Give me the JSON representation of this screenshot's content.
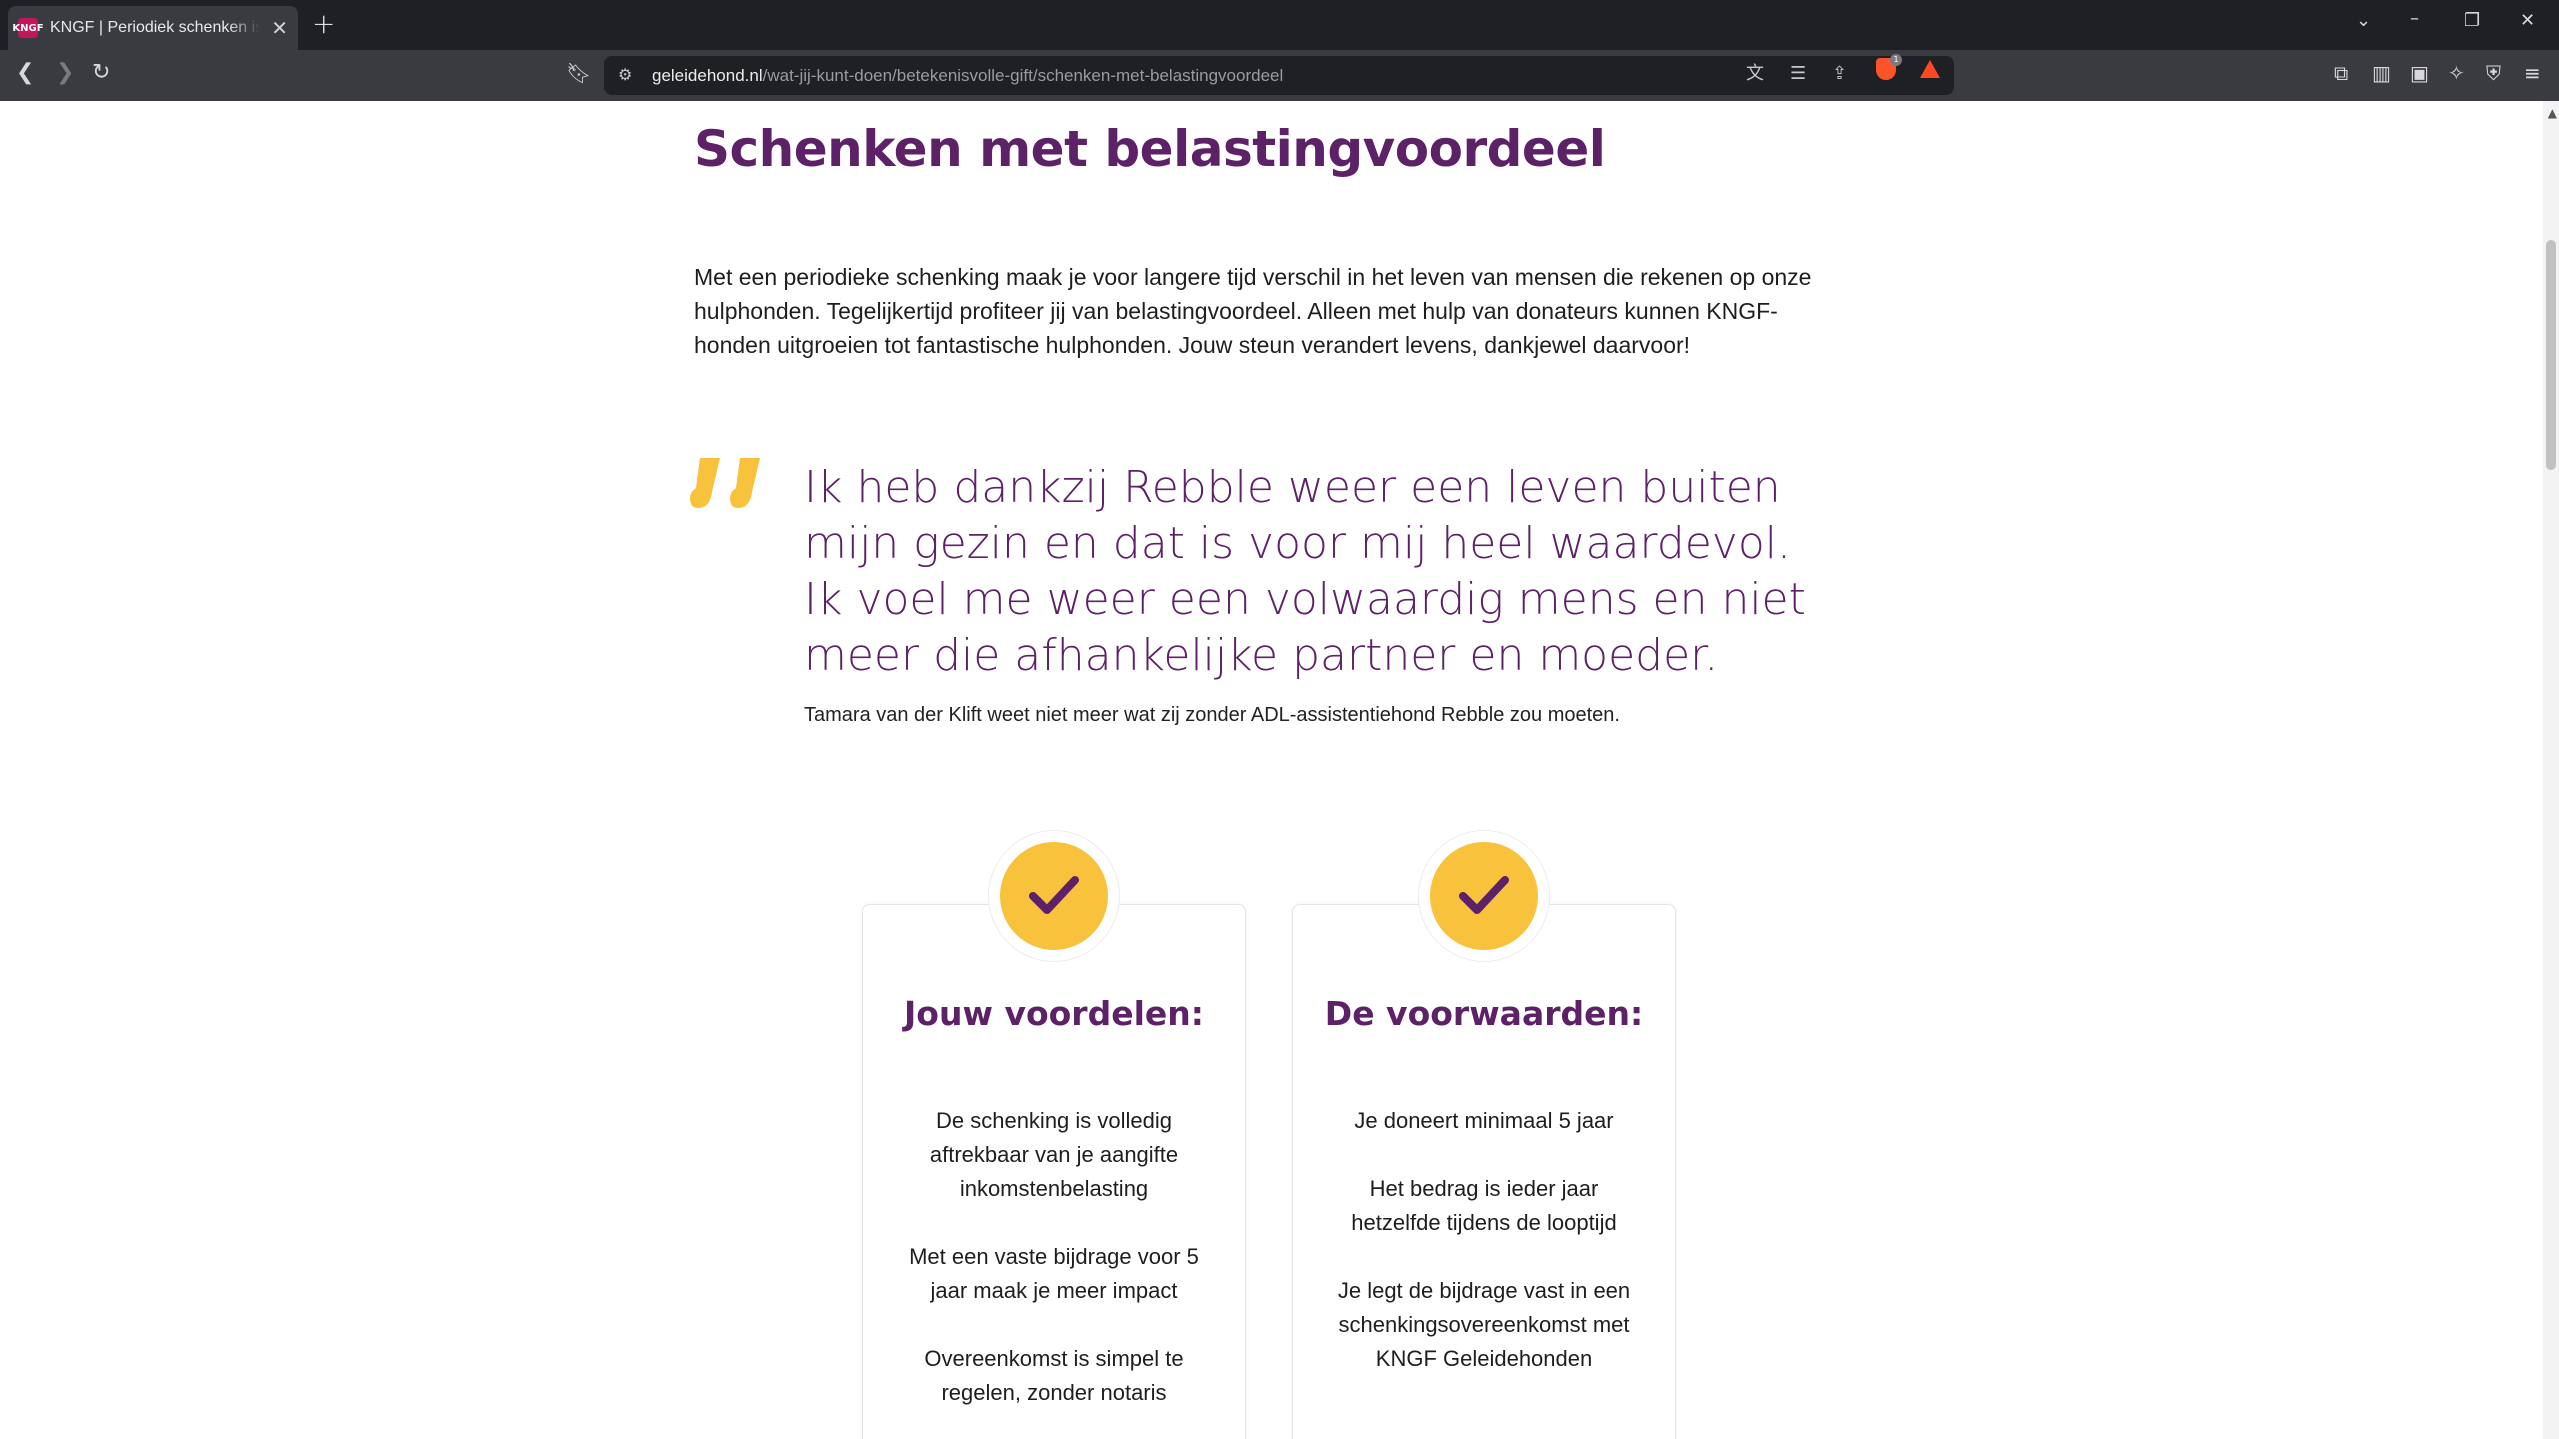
{
  "browser": {
    "tab": {
      "favicon": "KNGF",
      "title": "KNGF | Periodiek schenken is al"
    },
    "url": {
      "domain": "geleidehond.nl",
      "path": "/wat-jij-kunt-doen/betekenisvolle-gift/schenken-met-belastingvoordeel"
    },
    "brave_badge": "1"
  },
  "page": {
    "title": "Schenken met belastingvoordeel",
    "intro": "Met een periodieke schenking maak je voor langere tijd verschil in het leven van mensen die rekenen op onze hulphonden. Tegelijkertijd profiteer jij van belastingvoordeel. Alleen met hulp van donateurs kunnen KNGF-honden uitgroeien tot fantastische hulphonden. Jouw steun verandert levens, dankjewel daarvoor!",
    "quote": {
      "text": "Ik heb dankzij Rebble weer een leven buiten mijn gezin en dat is voor mij heel waardevol. Ik voel me weer een volwaardig mens en niet meer die afhankelijke partner en moeder.",
      "attribution": "Tamara van der Klift weet niet meer wat zij zonder ADL-assistentiehond Rebble zou moeten."
    },
    "cards": [
      {
        "title": "Jouw voordelen:",
        "items": [
          "De schenking is volledig aftrekbaar van je aangifte inkomstenbelasting",
          "Met een vaste bijdrage voor 5 jaar maak je meer impact",
          "Overeenkomst is simpel te regelen, zonder notaris"
        ]
      },
      {
        "title": "De voorwaarden:",
        "items": [
          "Je doneert minimaal 5 jaar",
          "Het bedrag is ieder jaar hetzelfde tijdens de looptijd",
          "Je legt de bijdrage vast in een schenkingsovereenkomst met KNGF Geleidehonden"
        ]
      }
    ]
  },
  "colors": {
    "brand_purple": "#5c2166",
    "accent_yellow": "#f9c23c",
    "chrome_dark": "#1f2024",
    "chrome_toolbar": "#3a3b40"
  }
}
